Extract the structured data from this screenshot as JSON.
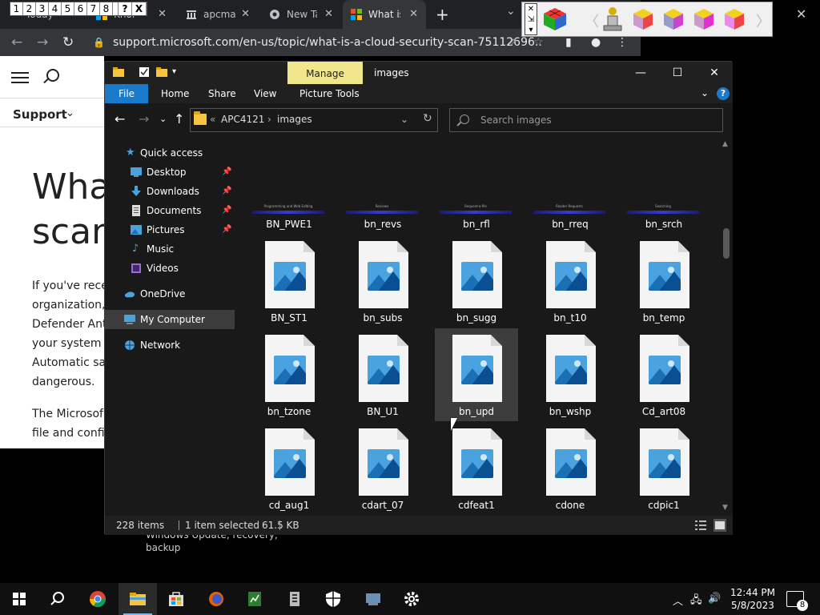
{
  "numbar": [
    "1",
    "2",
    "3",
    "4",
    "5",
    "6",
    "7",
    "8",
    "?",
    "X"
  ],
  "browser": {
    "tabs": [
      {
        "title": "Today",
        "icon": "flag-icon"
      },
      {
        "title": "Knol",
        "icon": "flag-icon"
      },
      {
        "title": "apcmag",
        "icon": "library-icon"
      },
      {
        "title": "New Tab",
        "icon": "chrome-icon"
      },
      {
        "title": "What is",
        "icon": "microsoft-icon"
      }
    ],
    "url": "support.microsoft.com/en-us/topic/what-is-a-cloud-security-scan-75112696...",
    "page": {
      "support_label": "Support",
      "title_line1": "What",
      "title_line2": "scan",
      "para1": [
        "If you've rece",
        "organization,",
        "Defender Ant",
        "your system",
        "Automatic sa",
        "dangerous."
      ],
      "para2": [
        "The Microsof",
        "file and confi"
      ]
    }
  },
  "settings_snippet": {
    "line1": "Windows Update, recovery,",
    "line2": "backup"
  },
  "explorer": {
    "manage_label": "Manage",
    "window_title": "images",
    "ribbon_tabs": [
      "File",
      "Home",
      "Share",
      "View",
      "Picture Tools"
    ],
    "breadcrumb": [
      "APC4121",
      "images"
    ],
    "search_placeholder": "Search images",
    "nav": {
      "quick_access": "Quick access",
      "desktop": "Desktop",
      "downloads": "Downloads",
      "documents": "Documents",
      "pictures": "Pictures",
      "music": "Music",
      "videos": "Videos",
      "onedrive": "OneDrive",
      "my_computer": "My Computer",
      "network": "Network"
    },
    "partial_row": {
      "captions": [
        "Programming and Web Editing",
        "Reviews",
        "Request-a-file",
        "Reader Requests",
        "Searching"
      ],
      "names": [
        "BN_PWE1",
        "bn_revs",
        "bn_rfl",
        "bn_rreq",
        "bn_srch"
      ]
    },
    "files": [
      [
        "BN_ST1",
        "bn_subs",
        "bn_sugg",
        "bn_t10",
        "bn_temp"
      ],
      [
        "bn_tzone",
        "BN_U1",
        "bn_upd",
        "bn_wshp",
        "Cd_art08"
      ],
      [
        "cd_aug1",
        "cdart_07",
        "cdfeat1",
        "cdone",
        "cdpic1"
      ]
    ],
    "selected_file": "bn_upd",
    "status": {
      "items": "228 items",
      "selected": "1 item selected",
      "size": "61.5 KB"
    }
  },
  "taskbar": {
    "time": "12:44 PM",
    "date": "5/8/2023",
    "notifications": "8"
  }
}
